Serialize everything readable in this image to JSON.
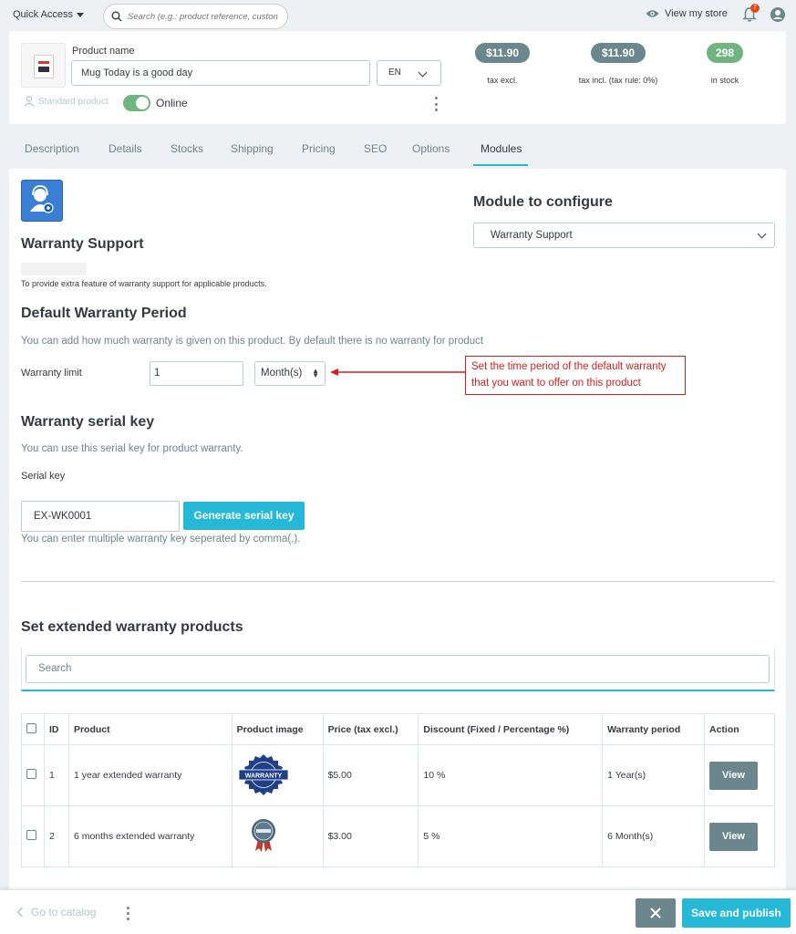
{
  "topbar": {
    "quick_access": "Quick Access",
    "search_placeholder": "Search (e.g.: product reference, custon",
    "view_store": "View my store",
    "notification_count": "7"
  },
  "product": {
    "name_label": "Product name",
    "name_value": "Mug Today is a good day",
    "language": "EN",
    "type": "Standard product",
    "status": "Online",
    "price_tax_excl": "$11.90",
    "price_tax_excl_caption": "tax excl.",
    "price_tax_incl": "$11.90",
    "price_tax_incl_caption": "tax incl. (tax rule: 0%)",
    "stock": "298",
    "stock_caption": "in stock"
  },
  "tabs": [
    {
      "label": "Description",
      "active": false
    },
    {
      "label": "Details",
      "active": false
    },
    {
      "label": "Stocks",
      "active": false
    },
    {
      "label": "Shipping",
      "active": false
    },
    {
      "label": "Pricing",
      "active": false
    },
    {
      "label": "SEO",
      "active": false
    },
    {
      "label": "Options",
      "active": false
    },
    {
      "label": "Modules",
      "active": true
    }
  ],
  "module": {
    "title": "Warranty Support",
    "description": "To provide extra feature of warranty support for applicable products.",
    "configure_heading": "Module to configure",
    "configure_selected": "Warranty Support"
  },
  "default_warranty": {
    "heading": "Default Warranty Period",
    "help": "You can add how much warranty is given on this product. By default there is no warranty for product",
    "limit_label": "Warranty limit",
    "limit_value": "1",
    "unit": "Month(s)",
    "callout": "Set the time period of the default warranty that you want to offer on this product"
  },
  "serial": {
    "heading": "Warranty serial key",
    "help": "You can use this serial key for product warranty.",
    "label": "Serial key",
    "value": "EX-WK0001",
    "generate_button": "Generate serial key",
    "note": "You can enter multiple warranty key seperated by comma(,)."
  },
  "extended": {
    "heading": "Set extended warranty products",
    "search_placeholder": "Search",
    "columns": [
      "ID",
      "Product",
      "Product image",
      "Price (tax excl.)",
      "Discount (Fixed / Percentage %)",
      "Warranty period",
      "Action"
    ],
    "rows": [
      {
        "id": "1",
        "product": "1 year extended warranty",
        "image_text": "WARRANTY",
        "price": "$5.00",
        "discount": "10 %",
        "period": "1 Year(s)",
        "action": "View"
      },
      {
        "id": "2",
        "product": "6 months extended warranty",
        "image_text": "",
        "price": "$3.00",
        "discount": "5 %",
        "period": "6 Month(s)",
        "action": "View"
      }
    ]
  },
  "footer": {
    "go_catalog": "Go to catalog",
    "save": "Save and publish"
  },
  "colors": {
    "primary": "#25b9d7",
    "secondary": "#6c868e",
    "success": "#70b580",
    "callout_red": "#d11f1f"
  }
}
